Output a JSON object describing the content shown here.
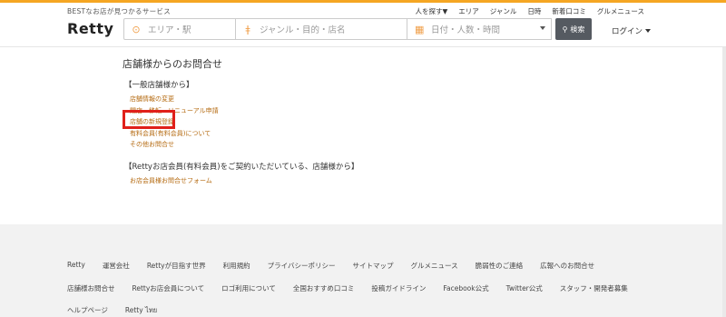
{
  "header": {
    "tagline": "BESTなお店が見つかるサービス",
    "logo": "Retty",
    "topnav": [
      "人を探す▼",
      "エリア",
      "ジャンル",
      "日時",
      "新着口コミ",
      "グルメニュース"
    ],
    "search": {
      "area_placeholder": "エリア・駅",
      "genre_placeholder": "ジャンル・目的・店名",
      "date_placeholder": "日付・人数・時間",
      "button_label": "検索"
    },
    "login_label": "ログイン"
  },
  "main": {
    "title": "店舗様からのお問合せ",
    "section1": {
      "heading": "【一般店舗様から】",
      "links": [
        "店舗情報の変更",
        "閉店・移転・リニューアル申請",
        "店舗の新規登録",
        "有料会員(有料会員)について",
        "その他お問合せ"
      ]
    },
    "section2": {
      "heading": "【Rettyお店会員(有料会員)をご契約いただいている、店舗様から】",
      "links": [
        "お店会員様お問合せフォーム"
      ]
    }
  },
  "footer": {
    "row1": [
      "Retty",
      "運営会社",
      "Rettyが目指す世界",
      "利用規約",
      "プライバシーポリシー",
      "サイトマップ",
      "グルメニュース",
      "脆弱性のご連絡",
      "広報へのお問合せ"
    ],
    "row2": [
      "店舗様お問合せ",
      "Rettyお店会員について",
      "ロゴ利用について",
      "全国おすすめ口コミ",
      "投稿ガイドライン",
      "Facebook公式",
      "Twitter公式",
      "スタッフ・開発者募集"
    ],
    "row3": [
      "ヘルプページ",
      "Retty ไทย"
    ]
  },
  "colors": {
    "accent": "#f5a623",
    "link": "#b56b12",
    "highlight": "#e0201a",
    "search_button": "#555a61",
    "footer_bg": "#f2f2f2"
  },
  "icons": {
    "area": "map-pin-icon",
    "genre": "fork-knife-icon",
    "date": "calendar-icon",
    "search": "magnifier-icon"
  }
}
